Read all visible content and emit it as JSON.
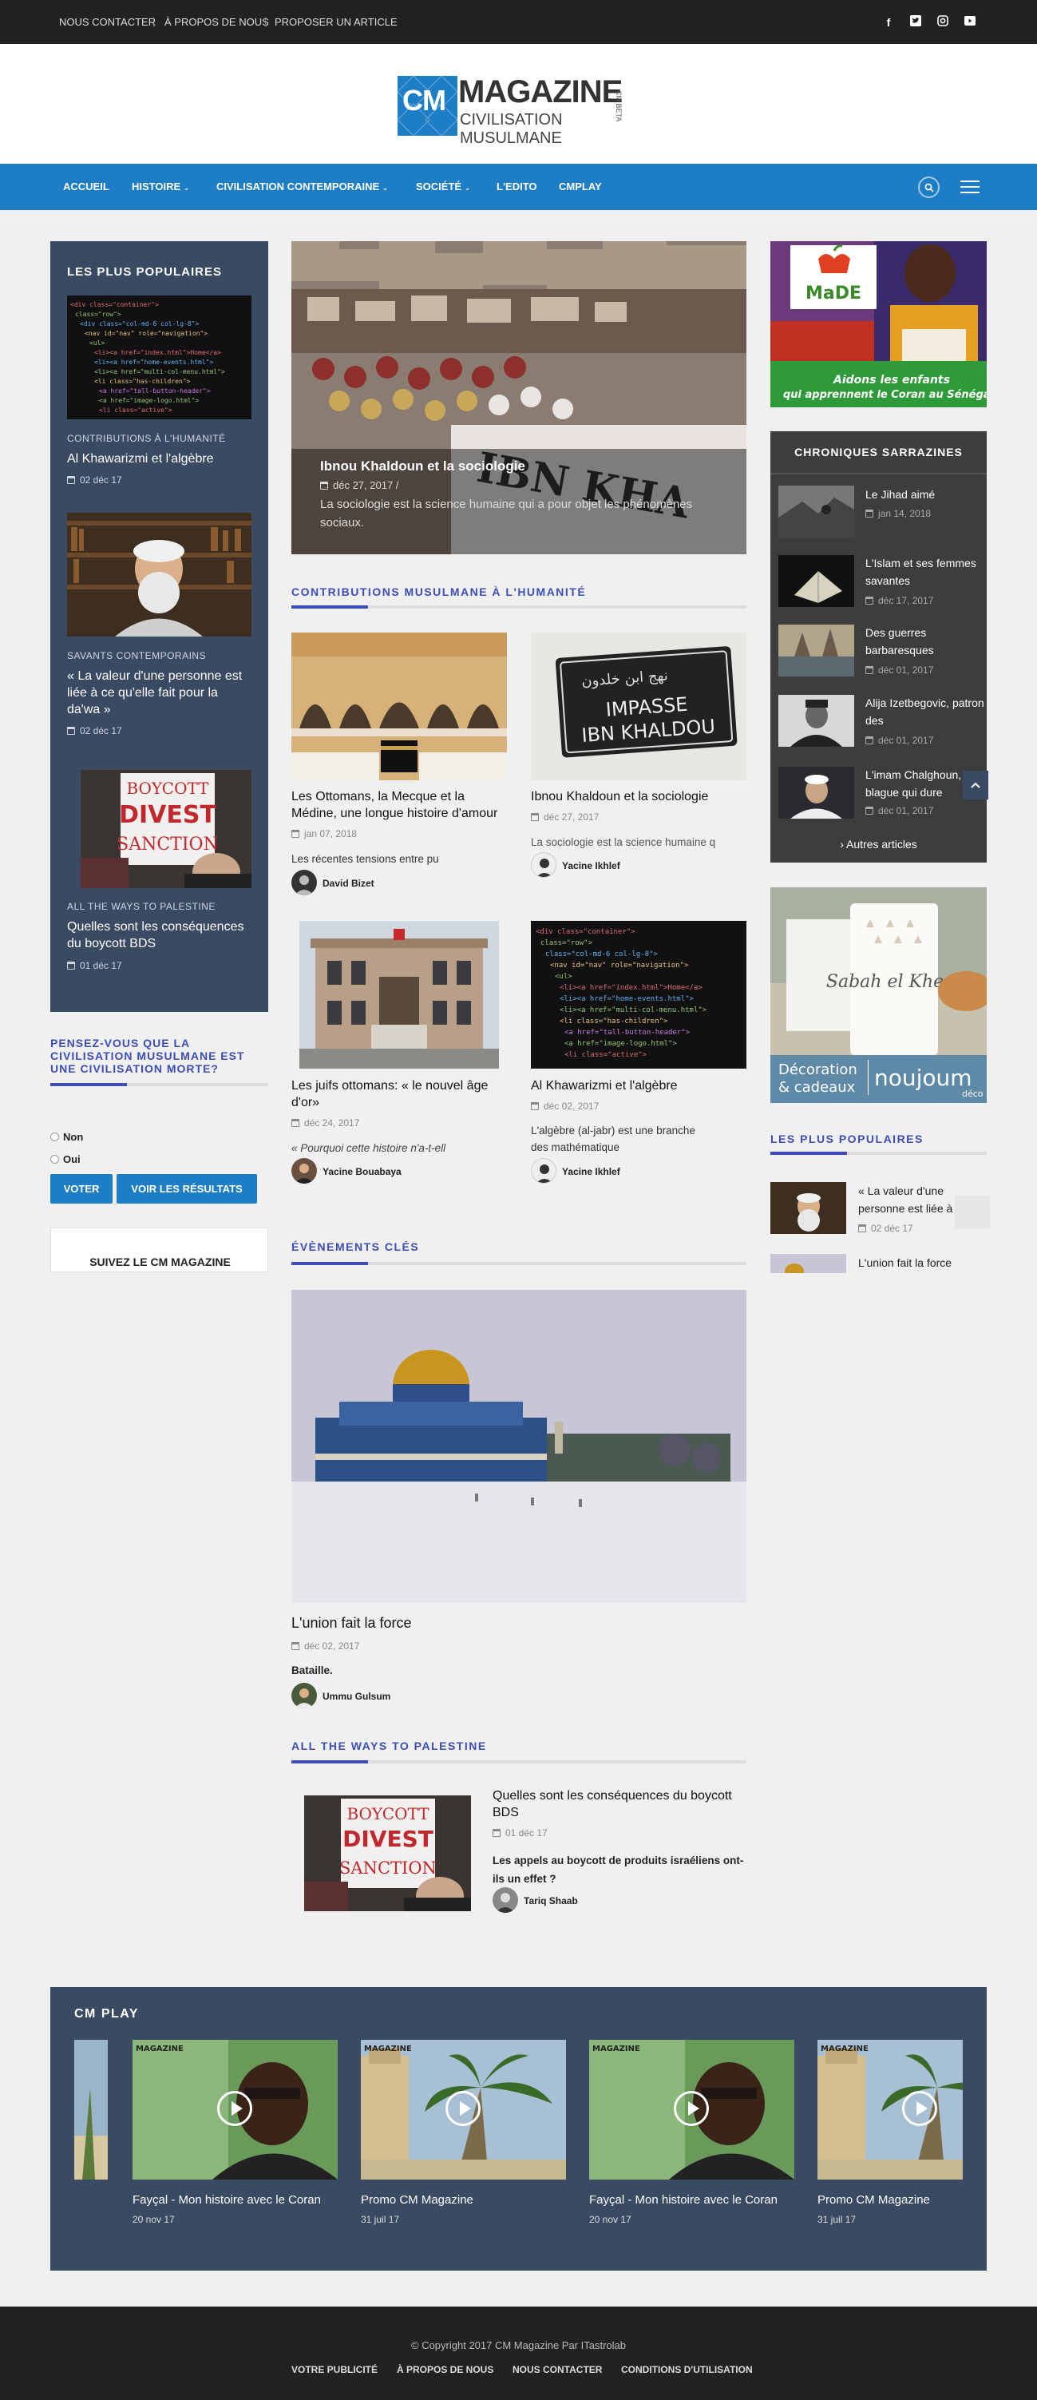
{
  "topbar": {
    "links": [
      "NOUS CONTACTER",
      "À PROPOS DE NOUS",
      "PROPOSER UN ARTICLE"
    ],
    "separator": "|"
  },
  "logo": {
    "cm": "CM",
    "magazine": "MAGAZINE",
    "side": "CM BETA",
    "subtitle": "CIVILISATION MUSULMANE"
  },
  "nav": {
    "items": [
      "ACCUEIL",
      "HISTOIRE",
      "CIVILISATION CONTEMPORAINE",
      "SOCIÉTÉ",
      "L'EDITO",
      "CMPLAY"
    ]
  },
  "left": {
    "title": "LES PLUS POPULAIRES",
    "items": [
      {
        "cat": "CONTRIBUTIONS À L'HUMANITÉ",
        "title": "Al Khawarizmi et l'algèbre",
        "date": "02 déc 17"
      },
      {
        "cat": "SAVANTS CONTEMPORAINS",
        "title": "« La valeur d'une personne est liée à ce qu'elle fait pour la da'wa »",
        "date": "02 déc 17"
      },
      {
        "cat": "ALL THE WAYS TO PALESTINE",
        "title": "Quelles sont les conséquences du boycott BDS",
        "date": "01 déc 17"
      }
    ]
  },
  "poll": {
    "question": "PENSEZ-VOUS QUE LA CIVILISATION MUSULMANE EST UNE CIVILISATION MORTE?",
    "options": [
      "Non",
      "Oui"
    ],
    "vote": "VOTER",
    "results": "VOIR LES RÉSULTATS"
  },
  "follow": {
    "title": "SUIVEZ LE CM MAGAZINE"
  },
  "hero": {
    "title": "Ibnou Khaldoun et la sociologie",
    "date": "déc 27, 2017 /",
    "excerpt": "La sociologie est la science humaine qui a pour objet les phénomènes sociaux.",
    "sign_text": "IBN KHA"
  },
  "contributions": {
    "title": "CONTRIBUTIONS MUSULMANE À L'HUMANITÉ",
    "cards": [
      {
        "title": "Les Ottomans, la Mecque et la Médine, une longue histoire d'amour",
        "date": "jan 07, 2018",
        "excerpt": "Les récentes tensions entre pu",
        "author": "David Bizet"
      },
      {
        "title": "Ibnou Khaldoun et la sociologie",
        "date": "déc 27, 2017",
        "excerpt": "La sociologie est la science humaine q",
        "author": "Yacine Ikhlef",
        "img_text": [
          "IMPASSE",
          "IBN KHALDOU"
        ]
      },
      {
        "title": "Les juifs ottomans: « le nouvel âge d'or»",
        "date": "déc 24, 2017",
        "excerpt": "« Pourquoi cette histoire n'a-t-ell",
        "author": "Yacine Bouabaya"
      },
      {
        "title": "Al Khawarizmi et l'algèbre",
        "date": "déc 02, 2017",
        "excerpt": "L'algèbre (al-jabr) est une branche des mathématique",
        "author": "Yacine Ikhlef"
      }
    ]
  },
  "events": {
    "title": "ÉVÈNEMENTS CLÉS",
    "card": {
      "title": "L'union fait la force",
      "date": "déc 02, 2017",
      "excerpt": "Bataille.",
      "author": "Ummu Gulsum"
    }
  },
  "palestine": {
    "title": "ALL THE WAYS TO PALESTINE",
    "card": {
      "title": "Quelles sont les conséquences du boycott BDS",
      "date": "01 déc 17",
      "excerpt": "Les appels au boycott de produits israéliens ont-ils un effet ?",
      "author": "Tariq Shaab",
      "sign": [
        "BOYCOTT",
        "DIVEST",
        "SANCTION"
      ]
    }
  },
  "ad1": {
    "brand": "MaDE",
    "line1": "Aidons les enfants",
    "line2": "qui apprennent le Coran au Sénégal"
  },
  "chroniques": {
    "title": "CHRONIQUES SARRAZINES",
    "items": [
      {
        "title": "Le Jihad aimé",
        "date": "jan 14, 2018"
      },
      {
        "title": "L'Islam et ses femmes savantes",
        "date": "déc 17, 2017"
      },
      {
        "title": "Des guerres barbaresques",
        "date": "déc 01, 2017"
      },
      {
        "title": "Alija Izetbegovic, patron des",
        "date": "déc 01, 2017"
      },
      {
        "title": "L'imam Chalghoun, la blague qui dure",
        "date": "déc 01, 2017"
      }
    ],
    "more": "› Autres articles"
  },
  "ad2": {
    "mug": "Sabah el Kheyr",
    "line1": "Décoration",
    "line2": "& cadeaux",
    "brand": "noujoum",
    "brand_sub": "déco"
  },
  "right_popular": {
    "title": "LES PLUS POPULAIRES",
    "items": [
      {
        "title": "« La valeur d'une personne est liée à ce",
        "date": "02 déc 17"
      },
      {
        "title": "L'union fait la force",
        "date": ""
      }
    ]
  },
  "cmplay": {
    "title": "CM PLAY",
    "logo_text": "MAGAZINE",
    "items": [
      {
        "title": "Fayçal - Mon histoire avec le Coran",
        "date": "20 nov 17"
      },
      {
        "title": "Promo CM Magazine",
        "date": "31 juil 17"
      },
      {
        "title": "Fayçal - Mon histoire avec le Coran",
        "date": "20 nov 17"
      },
      {
        "title": "Promo CM Magazine",
        "date": "31 juil 17"
      }
    ]
  },
  "footer": {
    "copyright": "© Copyright 2017 CM Magazine Par ITastrolab",
    "links": [
      "VOTRE PUBLICITÉ",
      "À PROPOS DE NOUS",
      "NOUS CONTACTER",
      "CONDITIONS D'UTILISATION"
    ]
  },
  "colors": {
    "nav": "#1d7dc5",
    "panel": "#3a4a63",
    "accent": "#3d4db8",
    "dark": "#222222"
  },
  "icons": [
    "facebook-icon",
    "twitter-icon",
    "instagram-icon",
    "youtube-icon",
    "search-icon",
    "menu-icon",
    "calendar-icon",
    "play-icon",
    "chevron-up-icon"
  ]
}
